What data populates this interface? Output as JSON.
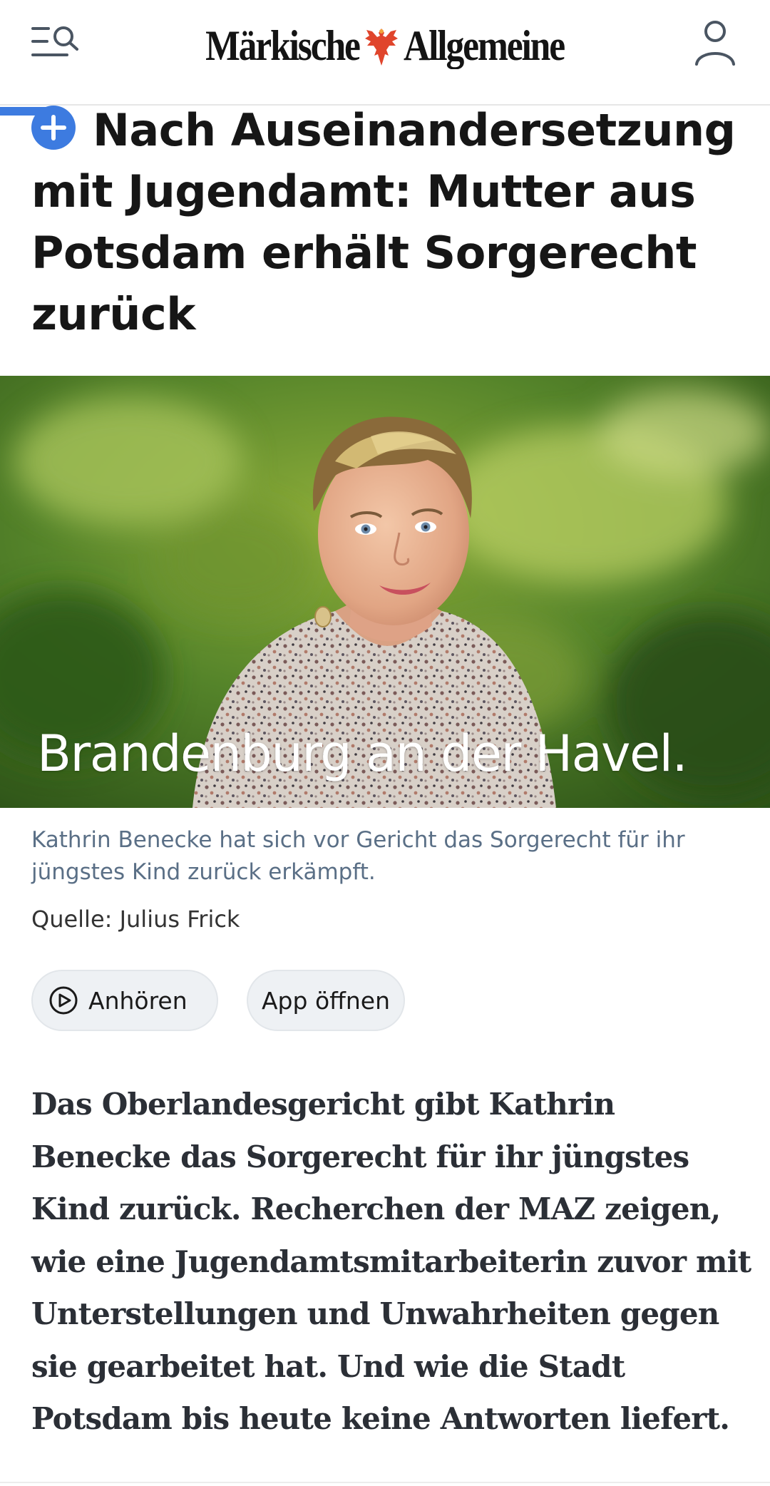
{
  "header": {
    "logo_word_left": "Märkische",
    "logo_word_right": "Allgemeine",
    "menu_icon": "menu-search-icon",
    "account_icon": "user-icon",
    "brand_accent": "#3d7be0"
  },
  "reading_progress": 0.08,
  "article": {
    "plus_badge_icon": "plus-icon",
    "headline": "Nach Auseinandersetzung mit Jugendamt: Mutter aus Potsdam erhält Sorgerecht zurück",
    "hero_overlay_text": "Brandenburg an der Havel.",
    "caption": "Kathrin Benecke hat sich vor Gericht das Sorgerecht für ihr jüngstes Kind zurück erkämpft.",
    "credit": "Quelle: Julius Frick",
    "teaser": "Das Oberlandesgericht gibt Kathrin Benecke das Sorgerecht für ihr jüngstes Kind zurück. Recherchen der MAZ zeigen, wie eine Jugendamtsmitarbeiterin zuvor mit Unterstellungen und Unwahrheiten gegen sie gearbeitet hat. Und wie die Stadt Potsdam bis heute keine Antworten liefert."
  },
  "actions": {
    "listen_label": "Anhören",
    "listen_icon": "play-circle-icon",
    "app_label": "App öffnen"
  }
}
